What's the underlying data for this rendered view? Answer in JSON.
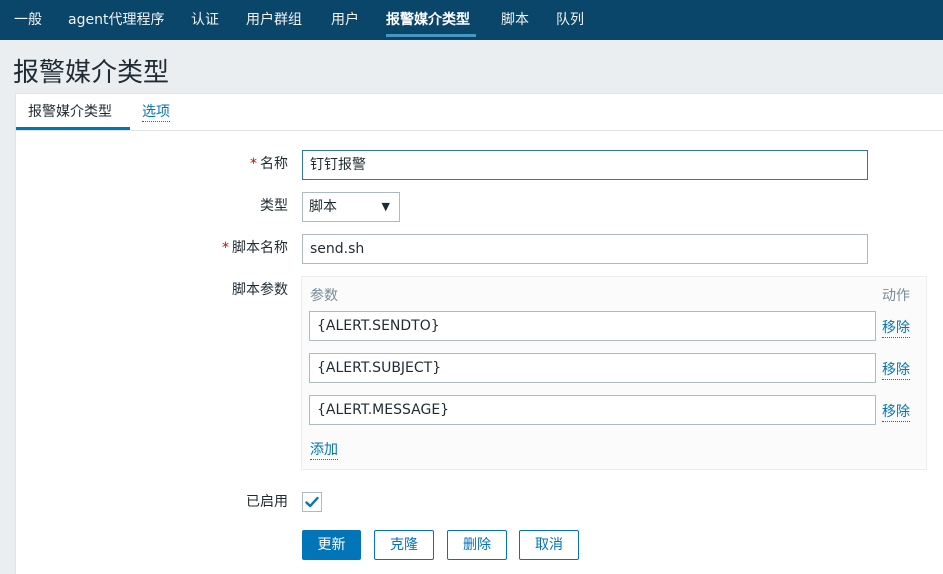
{
  "nav": {
    "items": [
      {
        "label": "一般"
      },
      {
        "label": "agent代理程序"
      },
      {
        "label": "认证"
      },
      {
        "label": "用户群组"
      },
      {
        "label": "用户"
      },
      {
        "label": "报警媒介类型",
        "active": true
      },
      {
        "label": "脚本"
      },
      {
        "label": "队列"
      }
    ]
  },
  "page": {
    "title": "报警媒介类型"
  },
  "tabs": [
    {
      "label": "报警媒介类型",
      "active": true
    },
    {
      "label": "选项",
      "active": false
    }
  ],
  "form": {
    "required_mark": "*",
    "name_label": "名称",
    "name_value": "钉钉报警",
    "type_label": "类型",
    "type_value": "脚本",
    "script_name_label": "脚本名称",
    "script_name_value": "send.sh",
    "params_label": "脚本参数",
    "params_col_header": "参数",
    "params_action_header": "动作",
    "params": [
      {
        "value": "{ALERT.SENDTO}",
        "remove_label": "移除"
      },
      {
        "value": "{ALERT.SUBJECT}",
        "remove_label": "移除"
      },
      {
        "value": "{ALERT.MESSAGE}",
        "remove_label": "移除"
      }
    ],
    "add_label": "添加",
    "enabled_label": "已启用",
    "enabled": true
  },
  "buttons": {
    "update": "更新",
    "clone": "克隆",
    "delete": "删除",
    "cancel": "取消"
  },
  "colors": {
    "nav_bg": "#0a466a",
    "accent": "#0275b8",
    "required": "#d40000"
  }
}
